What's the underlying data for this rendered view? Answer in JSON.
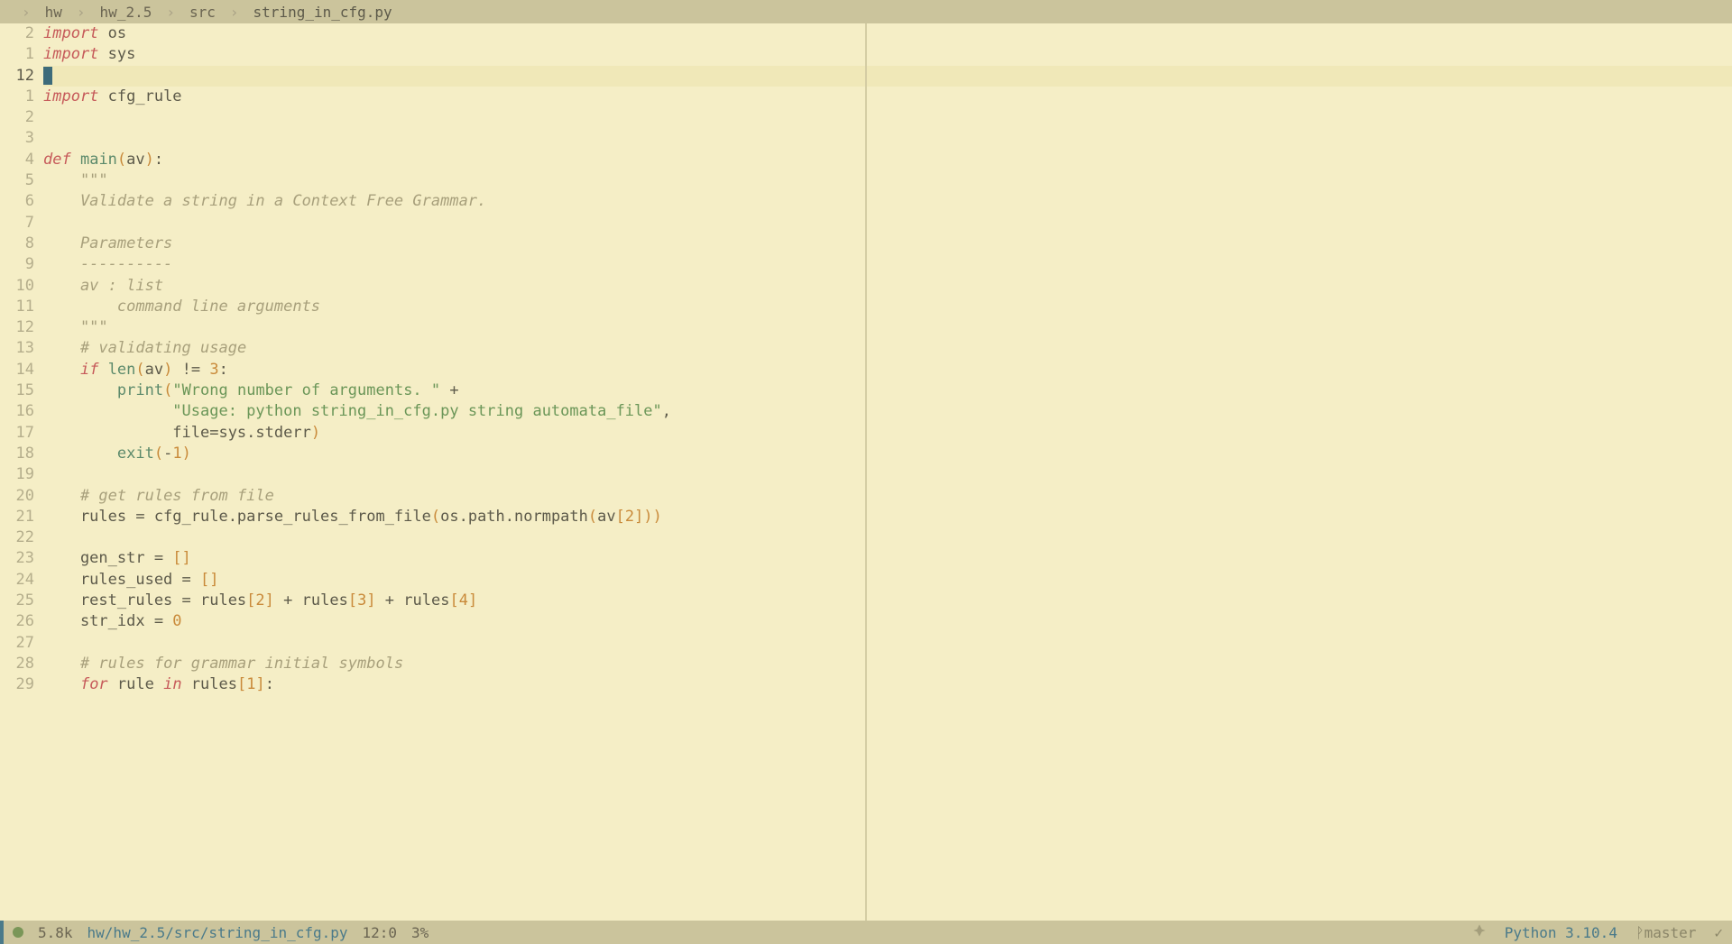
{
  "breadcrumb": {
    "parts": [
      "hw",
      "hw_2.5",
      "src",
      "string_in_cfg.py"
    ]
  },
  "editor": {
    "current_line_index": 2,
    "line_numbers": [
      "2",
      "1",
      "12",
      "1",
      "2",
      "3",
      "4",
      "5",
      "6",
      "7",
      "8",
      "9",
      "10",
      "11",
      "12",
      "13",
      "14",
      "15",
      "16",
      "17",
      "18",
      "19",
      "20",
      "21",
      "22",
      "23",
      "24",
      "25",
      "26",
      "27",
      "28",
      "29"
    ],
    "lines": [
      {
        "segments": [
          {
            "text": "import",
            "class": "kw-import"
          },
          {
            "text": " os",
            "class": "module-name"
          }
        ]
      },
      {
        "segments": [
          {
            "text": "import",
            "class": "kw-import"
          },
          {
            "text": " sys",
            "class": "module-name"
          }
        ]
      },
      {
        "segments": [],
        "cursor": true,
        "highlight": true
      },
      {
        "segments": [
          {
            "text": "import",
            "class": "kw-import"
          },
          {
            "text": " cfg_rule",
            "class": "module-name"
          }
        ]
      },
      {
        "segments": []
      },
      {
        "segments": []
      },
      {
        "segments": [
          {
            "text": "def",
            "class": "kw-def"
          },
          {
            "text": " ",
            "class": ""
          },
          {
            "text": "main",
            "class": "fn-name"
          },
          {
            "text": "(",
            "class": "paren"
          },
          {
            "text": "av",
            "class": "param"
          },
          {
            "text": ")",
            "class": "paren"
          },
          {
            "text": ":",
            "class": "operator"
          }
        ]
      },
      {
        "segments": [
          {
            "text": "    \"\"\"",
            "class": "docstring"
          }
        ]
      },
      {
        "segments": [
          {
            "text": "    Validate a string in a Context Free Grammar.",
            "class": "docstring"
          }
        ]
      },
      {
        "segments": []
      },
      {
        "segments": [
          {
            "text": "    Parameters",
            "class": "docstring"
          }
        ]
      },
      {
        "segments": [
          {
            "text": "    ----------",
            "class": "docstring"
          }
        ]
      },
      {
        "segments": [
          {
            "text": "    av : list",
            "class": "docstring"
          }
        ]
      },
      {
        "segments": [
          {
            "text": "        command line arguments",
            "class": "docstring"
          }
        ]
      },
      {
        "segments": [
          {
            "text": "    \"\"\"",
            "class": "docstring"
          }
        ]
      },
      {
        "segments": [
          {
            "text": "    ",
            "class": ""
          },
          {
            "text": "# validating usage",
            "class": "comment"
          }
        ]
      },
      {
        "segments": [
          {
            "text": "    ",
            "class": ""
          },
          {
            "text": "if",
            "class": "kw-if"
          },
          {
            "text": " ",
            "class": ""
          },
          {
            "text": "len",
            "class": "builtin"
          },
          {
            "text": "(",
            "class": "paren"
          },
          {
            "text": "av",
            "class": "param"
          },
          {
            "text": ")",
            "class": "paren"
          },
          {
            "text": " != ",
            "class": "operator"
          },
          {
            "text": "3",
            "class": "number"
          },
          {
            "text": ":",
            "class": "operator"
          }
        ]
      },
      {
        "segments": [
          {
            "text": "        ",
            "class": ""
          },
          {
            "text": "print",
            "class": "builtin"
          },
          {
            "text": "(",
            "class": "paren"
          },
          {
            "text": "\"Wrong number of arguments. \"",
            "class": "string"
          },
          {
            "text": " +",
            "class": "operator"
          }
        ]
      },
      {
        "segments": [
          {
            "text": "              ",
            "class": ""
          },
          {
            "text": "\"Usage: python string_in_cfg.py string automata_file\"",
            "class": "string"
          },
          {
            "text": ",",
            "class": "operator"
          }
        ]
      },
      {
        "segments": [
          {
            "text": "              file=sys.stderr",
            "class": "param"
          },
          {
            "text": ")",
            "class": "paren"
          }
        ]
      },
      {
        "segments": [
          {
            "text": "        ",
            "class": ""
          },
          {
            "text": "exit",
            "class": "builtin"
          },
          {
            "text": "(",
            "class": "paren"
          },
          {
            "text": "-",
            "class": "operator"
          },
          {
            "text": "1",
            "class": "number"
          },
          {
            "text": ")",
            "class": "paren"
          }
        ]
      },
      {
        "segments": []
      },
      {
        "segments": [
          {
            "text": "    ",
            "class": ""
          },
          {
            "text": "# get rules from file",
            "class": "comment"
          }
        ]
      },
      {
        "segments": [
          {
            "text": "    rules = cfg_rule.parse_rules_from_file",
            "class": "param"
          },
          {
            "text": "(",
            "class": "paren"
          },
          {
            "text": "os.path.normpath",
            "class": "param"
          },
          {
            "text": "(",
            "class": "paren"
          },
          {
            "text": "av",
            "class": "param"
          },
          {
            "text": "[",
            "class": "bracket"
          },
          {
            "text": "2",
            "class": "number"
          },
          {
            "text": "]",
            "class": "bracket"
          },
          {
            "text": "))",
            "class": "paren"
          }
        ]
      },
      {
        "segments": []
      },
      {
        "segments": [
          {
            "text": "    gen_str = ",
            "class": "param"
          },
          {
            "text": "[]",
            "class": "bracket"
          }
        ]
      },
      {
        "segments": [
          {
            "text": "    rules_used = ",
            "class": "param"
          },
          {
            "text": "[]",
            "class": "bracket"
          }
        ]
      },
      {
        "segments": [
          {
            "text": "    rest_rules = rules",
            "class": "param"
          },
          {
            "text": "[",
            "class": "bracket"
          },
          {
            "text": "2",
            "class": "number"
          },
          {
            "text": "]",
            "class": "bracket"
          },
          {
            "text": " + rules",
            "class": "param"
          },
          {
            "text": "[",
            "class": "bracket"
          },
          {
            "text": "3",
            "class": "number"
          },
          {
            "text": "]",
            "class": "bracket"
          },
          {
            "text": " + rules",
            "class": "param"
          },
          {
            "text": "[",
            "class": "bracket"
          },
          {
            "text": "4",
            "class": "number"
          },
          {
            "text": "]",
            "class": "bracket"
          }
        ]
      },
      {
        "segments": [
          {
            "text": "    str_idx = ",
            "class": "param"
          },
          {
            "text": "0",
            "class": "number"
          }
        ]
      },
      {
        "segments": []
      },
      {
        "segments": [
          {
            "text": "    ",
            "class": ""
          },
          {
            "text": "# rules for grammar initial symbols",
            "class": "comment"
          }
        ]
      },
      {
        "segments": [
          {
            "text": "    ",
            "class": ""
          },
          {
            "text": "for",
            "class": "kw-for"
          },
          {
            "text": " rule ",
            "class": "param"
          },
          {
            "text": "in",
            "class": "kw-in"
          },
          {
            "text": " rules",
            "class": "param"
          },
          {
            "text": "[",
            "class": "bracket"
          },
          {
            "text": "1",
            "class": "number"
          },
          {
            "text": "]",
            "class": "bracket"
          },
          {
            "text": ":",
            "class": "operator"
          }
        ]
      }
    ]
  },
  "status": {
    "file_size": "5.8k",
    "path_prefix": "hw/hw_2.5/src/",
    "filename": "string_in_cfg.py",
    "cursor_pos": "12:0",
    "scroll_pct": "3%",
    "python_version": "Python 3.10.4",
    "branch_icon": "ᚹ",
    "branch": "master",
    "rocket": "🚀",
    "check": "✓"
  }
}
